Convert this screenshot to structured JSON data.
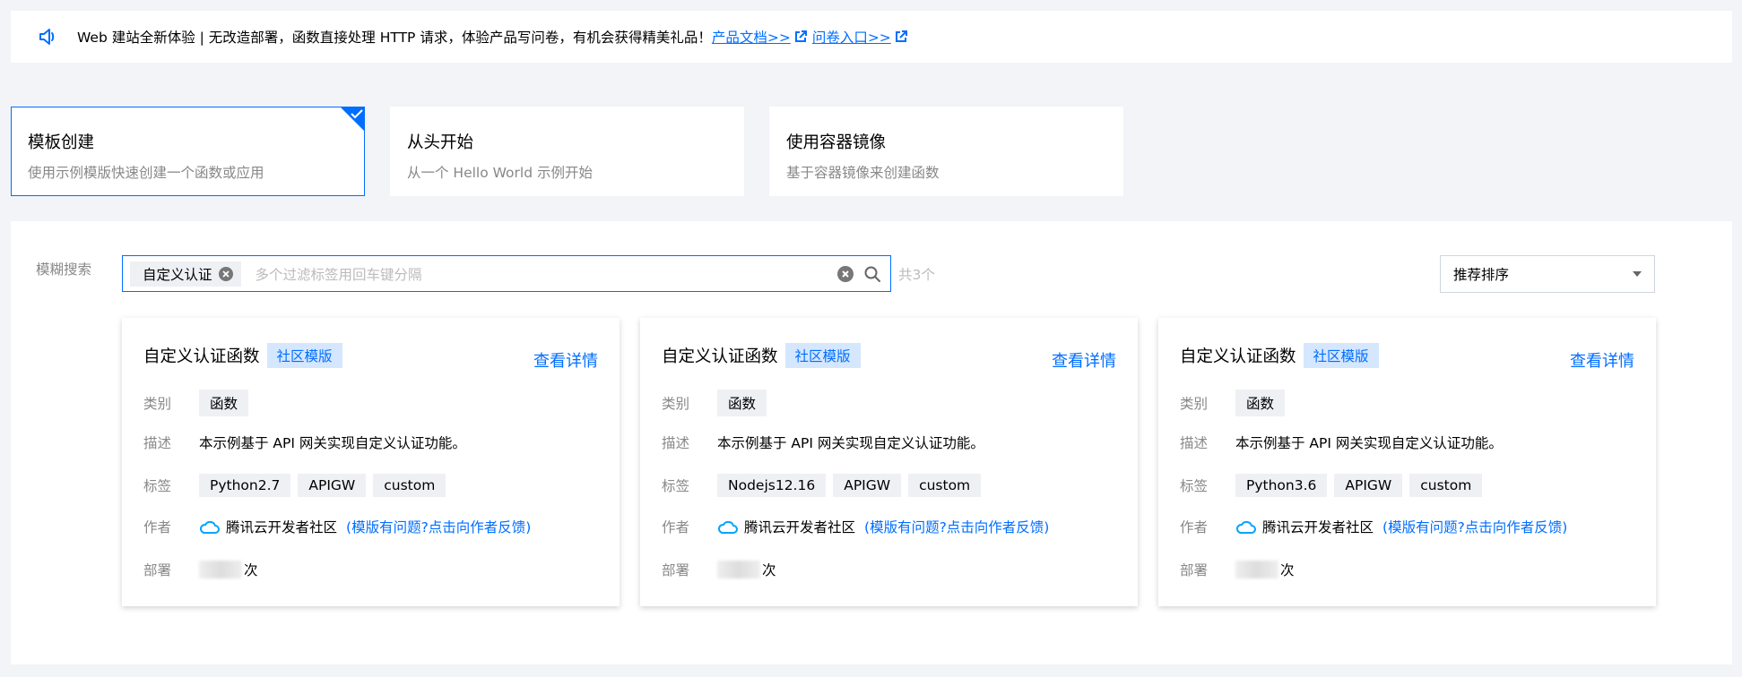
{
  "notice": {
    "text": "Web 建站全新体验 | 无改造部署，函数直接处理 HTTP 请求，体验产品写问卷，有机会获得精美礼品！",
    "link_docs": "产品文档>>",
    "link_survey": "问卷入口>>"
  },
  "modes": [
    {
      "title": "模板创建",
      "desc": "使用示例模版快速创建一个函数或应用",
      "selected": true
    },
    {
      "title": "从头开始",
      "desc": "从一个 Hello World 示例开始",
      "selected": false
    },
    {
      "title": "使用容器镜像",
      "desc": "基于容器镜像来创建函数",
      "selected": false
    }
  ],
  "filter": {
    "label": "模糊搜索",
    "chip": "自定义认证",
    "placeholder": "多个过滤标签用回车键分隔",
    "count": "共3个"
  },
  "sort": {
    "selected": "推荐排序"
  },
  "labels": {
    "category": "类别",
    "desc": "描述",
    "tags": "标签",
    "author": "作者",
    "deploy": "部署",
    "detail": "查看详情",
    "badge": "社区模版",
    "feedback": "(模版有问题?点击向作者反馈)",
    "times_suffix": "次"
  },
  "templates": [
    {
      "name": "自定义认证函数",
      "category": "函数",
      "description": "本示例基于 API 网关实现自定义认证功能。",
      "tags": [
        "Python2.7",
        "APIGW",
        "custom"
      ],
      "author": "腾讯云开发者社区"
    },
    {
      "name": "自定义认证函数",
      "category": "函数",
      "description": "本示例基于 API 网关实现自定义认证功能。",
      "tags": [
        "Nodejs12.16",
        "APIGW",
        "custom"
      ],
      "author": "腾讯云开发者社区"
    },
    {
      "name": "自定义认证函数",
      "category": "函数",
      "description": "本示例基于 API 网关实现自定义认证功能。",
      "tags": [
        "Python3.6",
        "APIGW",
        "custom"
      ],
      "author": "腾讯云开发者社区"
    }
  ],
  "colors": {
    "accent": "#006eff",
    "badge_bg": "#d5e7ff",
    "tag_bg": "#eef0f4"
  }
}
